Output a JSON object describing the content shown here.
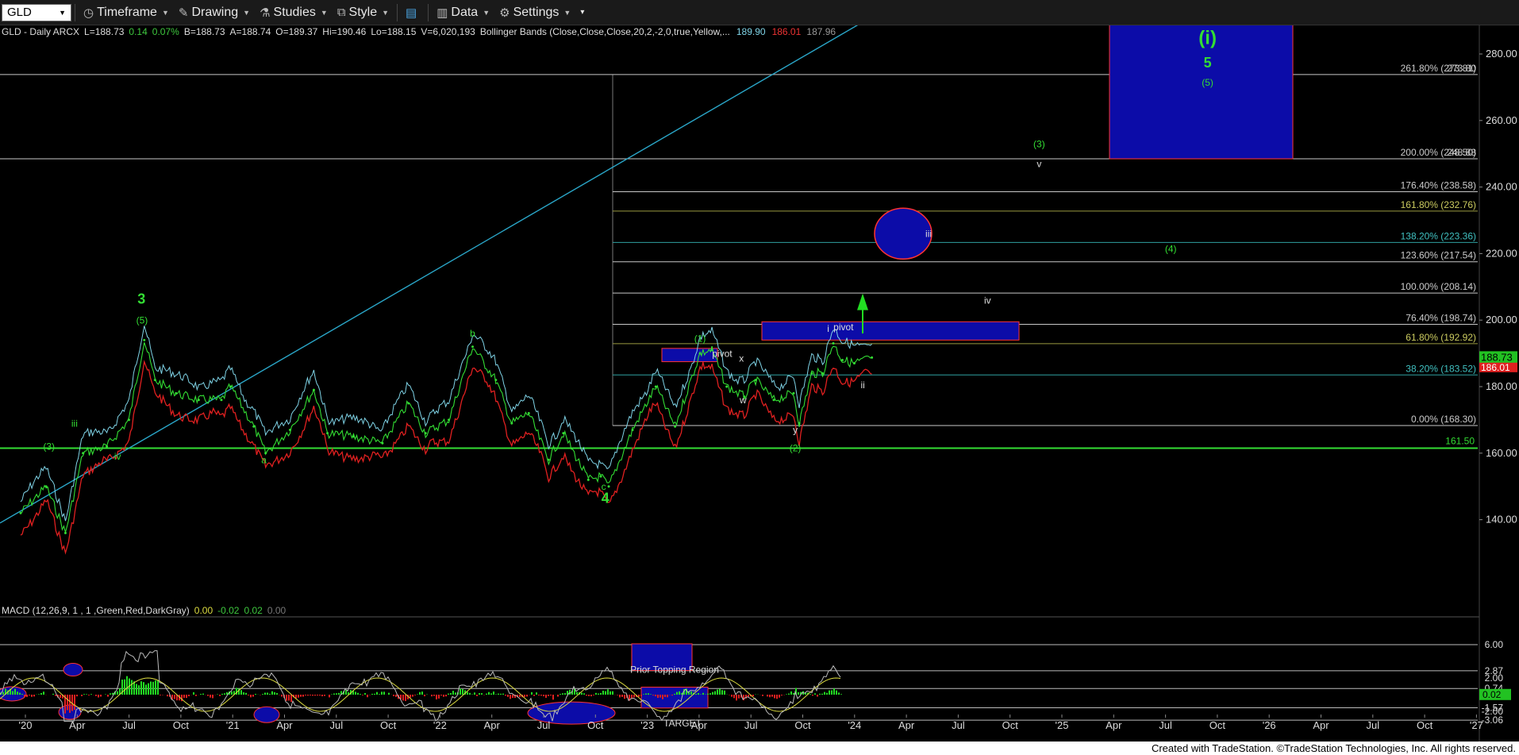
{
  "toolbar": {
    "symbol": "GLD",
    "timeframe": "Timeframe",
    "drawing": "Drawing",
    "studies": "Studies",
    "style": "Style",
    "data": "Data",
    "settings": "Settings"
  },
  "header": {
    "symbol_info": "GLD - Daily  ARCX",
    "last": "L=188.73",
    "change": "0.14",
    "change_pct": "0.07%",
    "bid": "B=188.73",
    "ask": "A=188.74",
    "open": "O=189.37",
    "high": "Hi=190.46",
    "low": "Lo=188.15",
    "volume": "V=6,020,193",
    "study": "Bollinger Bands (Close,Close,Close,20,2,-2,0,true,Yellow,...",
    "bb_upper": "189.90",
    "bb_lower": "186.01",
    "bb_mid": "187.96"
  },
  "macd_header": {
    "label": "MACD (12,26,9, 1 , 1 ,Green,Red,DarkGray)",
    "v1": "0.00",
    "v2": "-0.02",
    "v3": "0.02",
    "v4": "0.00"
  },
  "price_axis": {
    "ticks": [
      "280.00",
      "260.00",
      "240.00",
      "220.00",
      "200.00",
      "180.00",
      "160.00",
      "140.00"
    ],
    "last_price": "188.73",
    "lower_band": "186.01"
  },
  "macd_axis": {
    "ticks": [
      "6.00",
      "2.87",
      "2.00",
      "0.74",
      "0.02",
      "-1.57",
      "-2.00",
      "-3.06"
    ]
  },
  "time_axis": [
    "'20",
    "Apr",
    "Jul",
    "Oct",
    "'21",
    "Apr",
    "Jul",
    "Oct",
    "'22",
    "Apr",
    "Jul",
    "Oct",
    "'23",
    "Apr",
    "Jul",
    "Oct",
    "'24",
    "Apr",
    "Jul",
    "Oct",
    "'25",
    "Apr",
    "Jul",
    "Oct",
    "'26",
    "Apr",
    "Jul",
    "Oct",
    "'27"
  ],
  "fib_levels": [
    {
      "label": "261.80% (273.81)",
      "price": 273.81,
      "color": "#c8c8c8"
    },
    {
      "label": "200.00% (248.50)",
      "price": 248.5,
      "color": "#c8c8c8"
    },
    {
      "label": "176.40% (238.58)",
      "price": 238.58,
      "color": "#c8c8c8"
    },
    {
      "label": "161.80% (232.76)",
      "price": 232.76,
      "color": "#9a9a40"
    },
    {
      "label": "138.20% (223.36)",
      "price": 223.36,
      "color": "#2fa0a0"
    },
    {
      "label": "123.60% (217.54)",
      "price": 217.54,
      "color": "#c8c8c8"
    },
    {
      "label": "100.00% (208.14)",
      "price": 208.14,
      "color": "#c8c8c8"
    },
    {
      "label": "76.40% (198.74)",
      "price": 198.74,
      "color": "#c8c8c8"
    },
    {
      "label": "61.80% (192.92)",
      "price": 192.92,
      "color": "#9a9a40"
    },
    {
      "label": "38.20% (183.52)",
      "price": 183.52,
      "color": "#2fa0a0"
    },
    {
      "label": "0.00% (168.30)",
      "price": 168.3,
      "color": "#c8c8c8"
    }
  ],
  "fib_overlap_labels": [
    "273.80",
    "248.88"
  ],
  "support_level": {
    "label": "161.50",
    "price": 161.5
  },
  "wave_labels": {
    "3": "3",
    "4": "4",
    "5": "5",
    "i_big": "(i)",
    "p5": "(5)",
    "p5b": "(5)",
    "p3": "(3)",
    "p3b": "(3)",
    "p4": "(4)",
    "p1": "(1)",
    "p2": "(2)",
    "iii_left": "iii",
    "iv_left": "iv",
    "a": "a",
    "b": "b",
    "c": "c",
    "w": "w",
    "x": "x",
    "y": "y",
    "i": "i",
    "ii": "ii",
    "iii": "iii",
    "iv": "iv",
    "v": "v",
    "pivot1": "pivot",
    "pivot2": "pivot"
  },
  "macd_labels": {
    "prior_topping": "Prior Topping Region",
    "target": "TARGET"
  },
  "footer": "Created with TradeStation. ©TradeStation Technologies, Inc. All rights reserved.",
  "chart_data": {
    "type": "line",
    "title": "GLD - Daily",
    "x_range": [
      "2020-01",
      "2027-01"
    ],
    "ylim": [
      135,
      290
    ],
    "series": [
      {
        "name": "GLD",
        "values": [
          [
            "2020-01-01",
            142
          ],
          [
            "2020-02-15",
            150
          ],
          [
            "2020-03-20",
            136
          ],
          [
            "2020-04-20",
            160
          ],
          [
            "2020-06-01",
            162
          ],
          [
            "2020-07-10",
            170
          ],
          [
            "2020-08-06",
            194
          ],
          [
            "2020-08-25",
            182
          ],
          [
            "2020-10-01",
            178
          ],
          [
            "2020-11-10",
            176
          ],
          [
            "2020-12-20",
            176
          ],
          [
            "2021-01-05",
            180
          ],
          [
            "2021-02-15",
            168
          ],
          [
            "2021-03-08",
            160
          ],
          [
            "2021-04-20",
            167
          ],
          [
            "2021-06-01",
            179
          ],
          [
            "2021-06-25",
            166
          ],
          [
            "2021-08-10",
            165
          ],
          [
            "2021-09-30",
            163
          ],
          [
            "2021-11-15",
            175
          ],
          [
            "2021-12-15",
            166
          ],
          [
            "2022-01-25",
            170
          ],
          [
            "2022-03-08",
            192
          ],
          [
            "2022-04-18",
            182
          ],
          [
            "2022-05-16",
            169
          ],
          [
            "2022-06-15",
            172
          ],
          [
            "2022-07-20",
            158
          ],
          [
            "2022-08-15",
            166
          ],
          [
            "2022-09-28",
            152
          ],
          [
            "2022-10-20",
            153
          ],
          [
            "2022-11-03",
            150
          ],
          [
            "2022-12-15",
            167
          ],
          [
            "2023-01-25",
            180
          ],
          [
            "2023-02-28",
            168
          ],
          [
            "2023-04-13",
            190
          ],
          [
            "2023-05-04",
            191
          ],
          [
            "2023-05-30",
            180
          ],
          [
            "2023-06-30",
            177
          ],
          [
            "2023-07-20",
            182
          ],
          [
            "2023-08-21",
            176
          ],
          [
            "2023-09-25",
            178
          ],
          [
            "2023-10-05",
            169
          ],
          [
            "2023-10-27",
            184
          ],
          [
            "2023-11-15",
            184
          ],
          [
            "2023-12-04",
            193
          ],
          [
            "2023-12-20",
            188
          ],
          [
            "2024-01-10",
            187
          ],
          [
            "2024-02-10",
            188.73
          ]
        ]
      }
    ]
  }
}
